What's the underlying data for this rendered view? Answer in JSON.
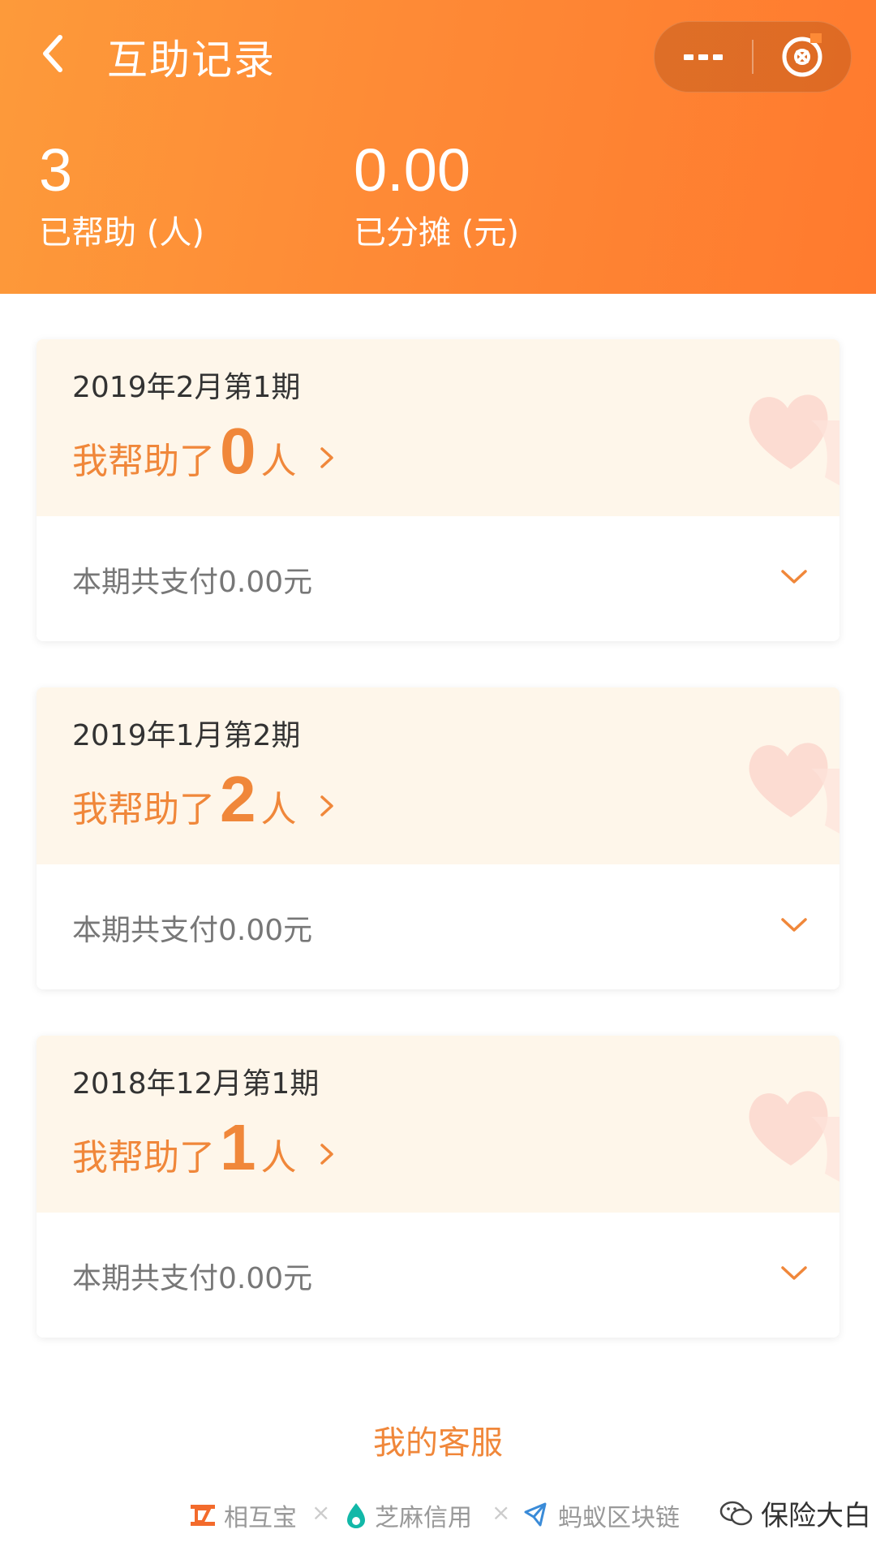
{
  "nav": {
    "title": "互助记录"
  },
  "stats": {
    "helped_count": "3",
    "helped_label": "已帮助 (人)",
    "shared_amount": "0.00",
    "shared_label": "已分摊 (元)"
  },
  "records": [
    {
      "period": "2019年2月第1期",
      "helped_prefix": "我帮助了",
      "helped_count": "0",
      "helped_suffix": "人",
      "paid": "本期共支付0.00元"
    },
    {
      "period": "2019年1月第2期",
      "helped_prefix": "我帮助了",
      "helped_count": "2",
      "helped_suffix": "人",
      "paid": "本期共支付0.00元"
    },
    {
      "period": "2018年12月第1期",
      "helped_prefix": "我帮助了",
      "helped_count": "1",
      "helped_suffix": "人",
      "paid": "本期共支付0.00元"
    }
  ],
  "service_link": "我的客服",
  "footer": {
    "brand1": "相互宝",
    "brand2": "芝麻信用",
    "brand3": "蚂蚁区块链",
    "separator": "×"
  },
  "watermark": "保险大白",
  "colors": {
    "header_start": "#fd9a3a",
    "header_end": "#ff7a2e",
    "accent": "#f0873a",
    "card_top_bg": "#fef6ea"
  },
  "icons": {
    "back": "back-arrow-icon",
    "more": "more-dots-icon",
    "close": "close-circle-icon",
    "chevron_right": "chevron-right-icon",
    "chevron_down": "chevron-down-icon",
    "heart": "heart-decoration-icon"
  }
}
